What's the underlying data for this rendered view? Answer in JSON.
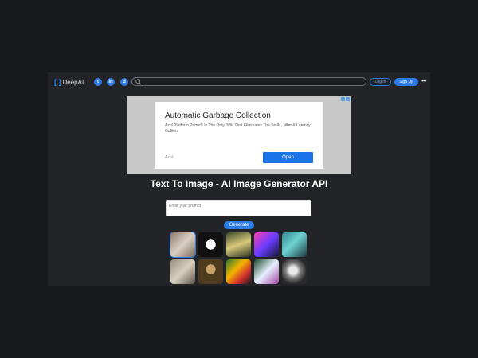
{
  "header": {
    "logo_brackets": "[ ]",
    "logo_text": "DeepAI",
    "social_icons": [
      "twitter-icon",
      "linkedin-icon",
      "discord-icon"
    ],
    "search_placeholder": "",
    "login_label": "Log In",
    "signup_label": "Sign Up",
    "more_label": "•••"
  },
  "ad": {
    "title": "Automatic Garbage Collection",
    "text": "Azul Platform Prime® Is The Only JVM That Eliminates The Stalls, Jitter & Latency Outliers",
    "source": "Azul",
    "cta": "Open"
  },
  "main": {
    "title": "Text To Image - AI Image Generator API",
    "prompt_placeholder": "Enter your prompt",
    "generate_label": "Generate"
  },
  "colors": {
    "accent": "#2d7be5",
    "background": "#222428",
    "outer": "#18191b"
  },
  "gallery": [
    {
      "name": "gallery-image-1-collage",
      "bg": "linear-gradient(135deg,#8a7a6a,#d9d0c4 50%,#7a6c5c)"
    },
    {
      "name": "gallery-image-2-panda",
      "bg": "radial-gradient(circle at 50% 50%,#fff 0 28%,#111 29% 100%)"
    },
    {
      "name": "gallery-image-3-forest",
      "bg": "linear-gradient(160deg,#3b4a2a,#d8c97a 50%,#2c3320)"
    },
    {
      "name": "gallery-image-4-robot",
      "bg": "linear-gradient(135deg,#ff3fb0,#6a3cff 50%,#18163a)"
    },
    {
      "name": "gallery-image-5-portrait",
      "bg": "linear-gradient(135deg,#2a8a8a,#6fd3d0 45%,#1c3a44)"
    },
    {
      "name": "gallery-image-6-statues",
      "bg": "linear-gradient(135deg,#9a8f7e,#d7cfbf 50%,#5d5549)"
    },
    {
      "name": "gallery-image-7-mona-lisa",
      "bg": "radial-gradient(circle at 50% 40%,#c6a268 0 25%,#4e3b1e 26% 100%)"
    },
    {
      "name": "gallery-image-8-fruit",
      "bg": "linear-gradient(135deg,#2e7d32,#f4b400 40%,#d32f2f 70%,#1b1b1b)"
    },
    {
      "name": "gallery-image-9-dancers",
      "bg": "linear-gradient(135deg,#1f4d2e,#e6f0ff 50%,#a54aa5)"
    },
    {
      "name": "gallery-image-10-sphere",
      "bg": "radial-gradient(circle at 45% 45%,#eaeaea 0 20%,#7a7a7a 40%,#2a2a2a 70%)"
    },
    {
      "name": "gallery-image-11",
      "bg": "linear-gradient(180deg,#8b5cf6,#5b21b6)"
    },
    {
      "name": "gallery-image-12",
      "bg": "linear-gradient(180deg,#7c3aed,#a855f7)"
    },
    {
      "name": "gallery-image-13",
      "bg": "linear-gradient(180deg,#ea580c,#7c2d12)"
    },
    {
      "name": "gallery-image-14",
      "bg": "linear-gradient(180deg,#b91c1c,#f59e0b)"
    },
    {
      "name": "gallery-image-15",
      "bg": "linear-gradient(180deg,#6b7280,#9ca3af)"
    }
  ]
}
